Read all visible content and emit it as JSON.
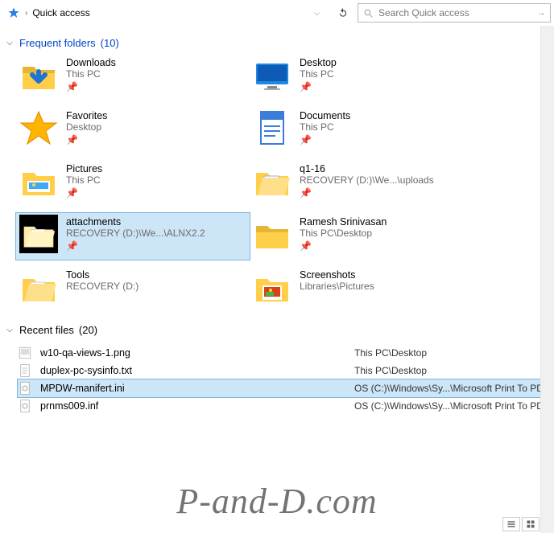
{
  "addressbar": {
    "icon": "quick-access-star",
    "crumb": "Quick access"
  },
  "search": {
    "placeholder": "Search Quick access"
  },
  "sections": {
    "frequent": {
      "label": "Frequent folders",
      "count": "(10)"
    },
    "recent": {
      "label": "Recent files",
      "count": "(20)"
    }
  },
  "folders": [
    {
      "id": "downloads",
      "name": "Downloads",
      "sub": "This PC",
      "icon": "folder-down",
      "pinned": true
    },
    {
      "id": "desktop",
      "name": "Desktop",
      "sub": "This PC",
      "icon": "desktop",
      "pinned": true
    },
    {
      "id": "favorites",
      "name": "Favorites",
      "sub": "Desktop",
      "icon": "star",
      "pinned": true
    },
    {
      "id": "documents",
      "name": "Documents",
      "sub": "This PC",
      "icon": "documents",
      "pinned": true
    },
    {
      "id": "pictures",
      "name": "Pictures",
      "sub": "This PC",
      "icon": "pictures",
      "pinned": true
    },
    {
      "id": "q116",
      "name": "q1-16",
      "sub": "RECOVERY (D:)\\We...\\uploads",
      "icon": "open-folder",
      "pinned": true
    },
    {
      "id": "attachments",
      "name": "attachments",
      "sub": "RECOVERY (D:)\\We...\\ALNX2.2",
      "icon": "open-folder-sel",
      "pinned": true,
      "selected": true
    },
    {
      "id": "ramesh",
      "name": "Ramesh Srinivasan",
      "sub": "This PC\\Desktop",
      "icon": "folder",
      "pinned": true
    },
    {
      "id": "tools",
      "name": "Tools",
      "sub": "RECOVERY (D:)",
      "icon": "open-folder",
      "pinned": false
    },
    {
      "id": "screenshots",
      "name": "Screenshots",
      "sub": "Libraries\\Pictures",
      "icon": "pictures-color",
      "pinned": false
    }
  ],
  "files": [
    {
      "name": "w10-qa-views-1.png",
      "path": "This PC\\Desktop",
      "icon": "img"
    },
    {
      "name": "duplex-pc-sysinfo.txt",
      "path": "This PC\\Desktop",
      "icon": "txt"
    },
    {
      "name": "MPDW-manifert.ini",
      "path": "OS (C:)\\Windows\\Sy...\\Microsoft Print To PDF",
      "icon": "ini",
      "selected": true
    },
    {
      "name": "prnms009.inf",
      "path": "OS (C:)\\Windows\\Sy...\\Microsoft Print To PDF",
      "icon": "ini"
    }
  ],
  "watermark": "P-and-D.com"
}
